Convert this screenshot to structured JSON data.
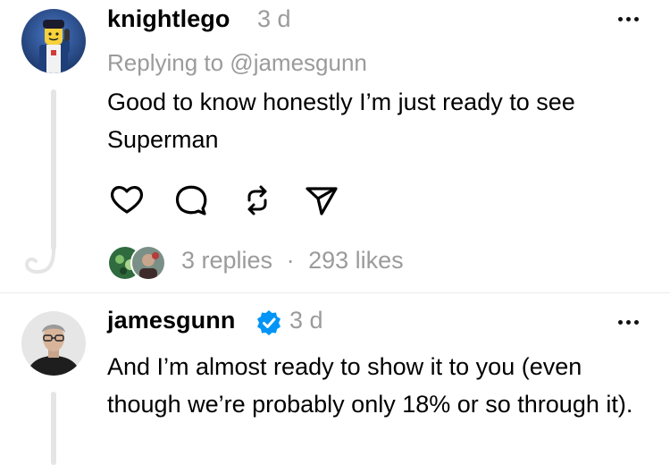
{
  "posts": [
    {
      "username": "knightlego",
      "time": "3 d",
      "reply_to": "Replying to @jamesgunn",
      "text": "Good to know honestly I’m just ready to see Superman",
      "actions": [
        "heart-icon",
        "comment-icon",
        "repost-icon",
        "share-icon"
      ],
      "stats": {
        "replies": "3 replies",
        "separator": "·",
        "likes": "293 likes"
      }
    },
    {
      "username": "jamesgunn",
      "verified": true,
      "time": "3 d",
      "text": "And I’m almost ready to show it to you (even though we’re probably only 18% or so through it)."
    }
  ],
  "colors": {
    "secondary_text": "#9b9b9b",
    "verified_badge": "#0095f6",
    "thread_line": "#e5e5e5"
  }
}
